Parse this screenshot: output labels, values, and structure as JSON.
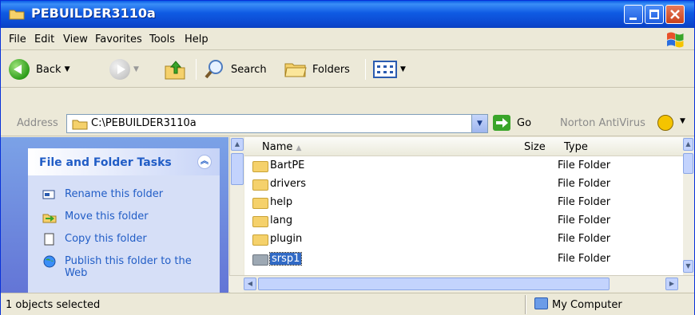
{
  "window": {
    "title": "PEBUILDER3110a"
  },
  "menu": [
    "File",
    "Edit",
    "View",
    "Favorites",
    "Tools",
    "Help"
  ],
  "toolbar": {
    "back": "Back",
    "search": "Search",
    "folders": "Folders"
  },
  "address": {
    "label": "Address",
    "path": "C:\\PEBUILDER3110a",
    "go": "Go",
    "norton": "Norton AntiVirus"
  },
  "tasks": {
    "header": "File and Folder Tasks",
    "items": [
      {
        "label": "Rename this folder",
        "icon": "rename-icon"
      },
      {
        "label": "Move this folder",
        "icon": "move-icon"
      },
      {
        "label": "Copy this folder",
        "icon": "copy-icon"
      },
      {
        "label": "Publish this folder to the Web",
        "icon": "publish-icon"
      }
    ]
  },
  "columns": {
    "name": "Name",
    "size": "Size",
    "type": "Type"
  },
  "files": [
    {
      "name": "BartPE",
      "type": "File Folder",
      "selected": false
    },
    {
      "name": "drivers",
      "type": "File Folder",
      "selected": false
    },
    {
      "name": "help",
      "type": "File Folder",
      "selected": false
    },
    {
      "name": "lang",
      "type": "File Folder",
      "selected": false
    },
    {
      "name": "plugin",
      "type": "File Folder",
      "selected": false
    },
    {
      "name": "srsp1",
      "type": "File Folder",
      "selected": true
    }
  ],
  "status": {
    "left": "1 objects selected",
    "right": "My Computer"
  },
  "colors": {
    "title_blue": "#0b48d0",
    "task_link": "#215dc6",
    "selection": "#316ac5"
  }
}
